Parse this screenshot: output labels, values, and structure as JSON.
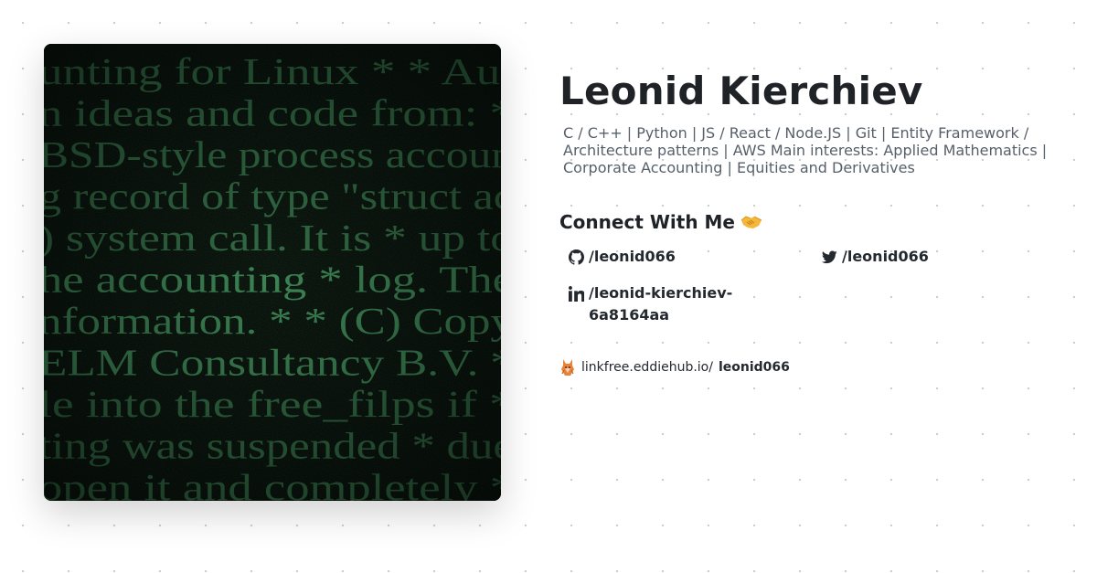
{
  "profile": {
    "name": "Leonid Kierchiev",
    "bio": "C / C++ | Python | JS / React / Node.JS | Git | Entity Framework / Architecture patterns | AWS Main interests: Applied Mathematics | Corporate Accounting | Equities and Derivatives"
  },
  "connect": {
    "heading": "Connect With Me",
    "links": [
      {
        "icon": "github-icon",
        "label": "/leonid066"
      },
      {
        "icon": "twitter-icon",
        "label": "/leonid066"
      },
      {
        "icon": "linkedin-icon",
        "label": "/leonid-kierchiev-6a8164aa"
      }
    ]
  },
  "linkfree": {
    "host": "linkfree.eddiehub.io/",
    "user": "leonid066"
  },
  "image": {
    "lines": [
      "unting for Linux * * Aut",
      "n ideas and code from: *",
      "BSD-style process accoun",
      "g record of type \"struct ac",
      ") system call. It is * up to",
      "he accounting * log. The",
      "nformation. * * (C) Copy",
      "ELM Consultancy B.V. *",
      "le into the free_filps if *",
      "ting was suspended * due",
      "open it and completely *"
    ]
  },
  "colors": {
    "code_text": "#3d8a57",
    "code_bg": "#040a06"
  }
}
